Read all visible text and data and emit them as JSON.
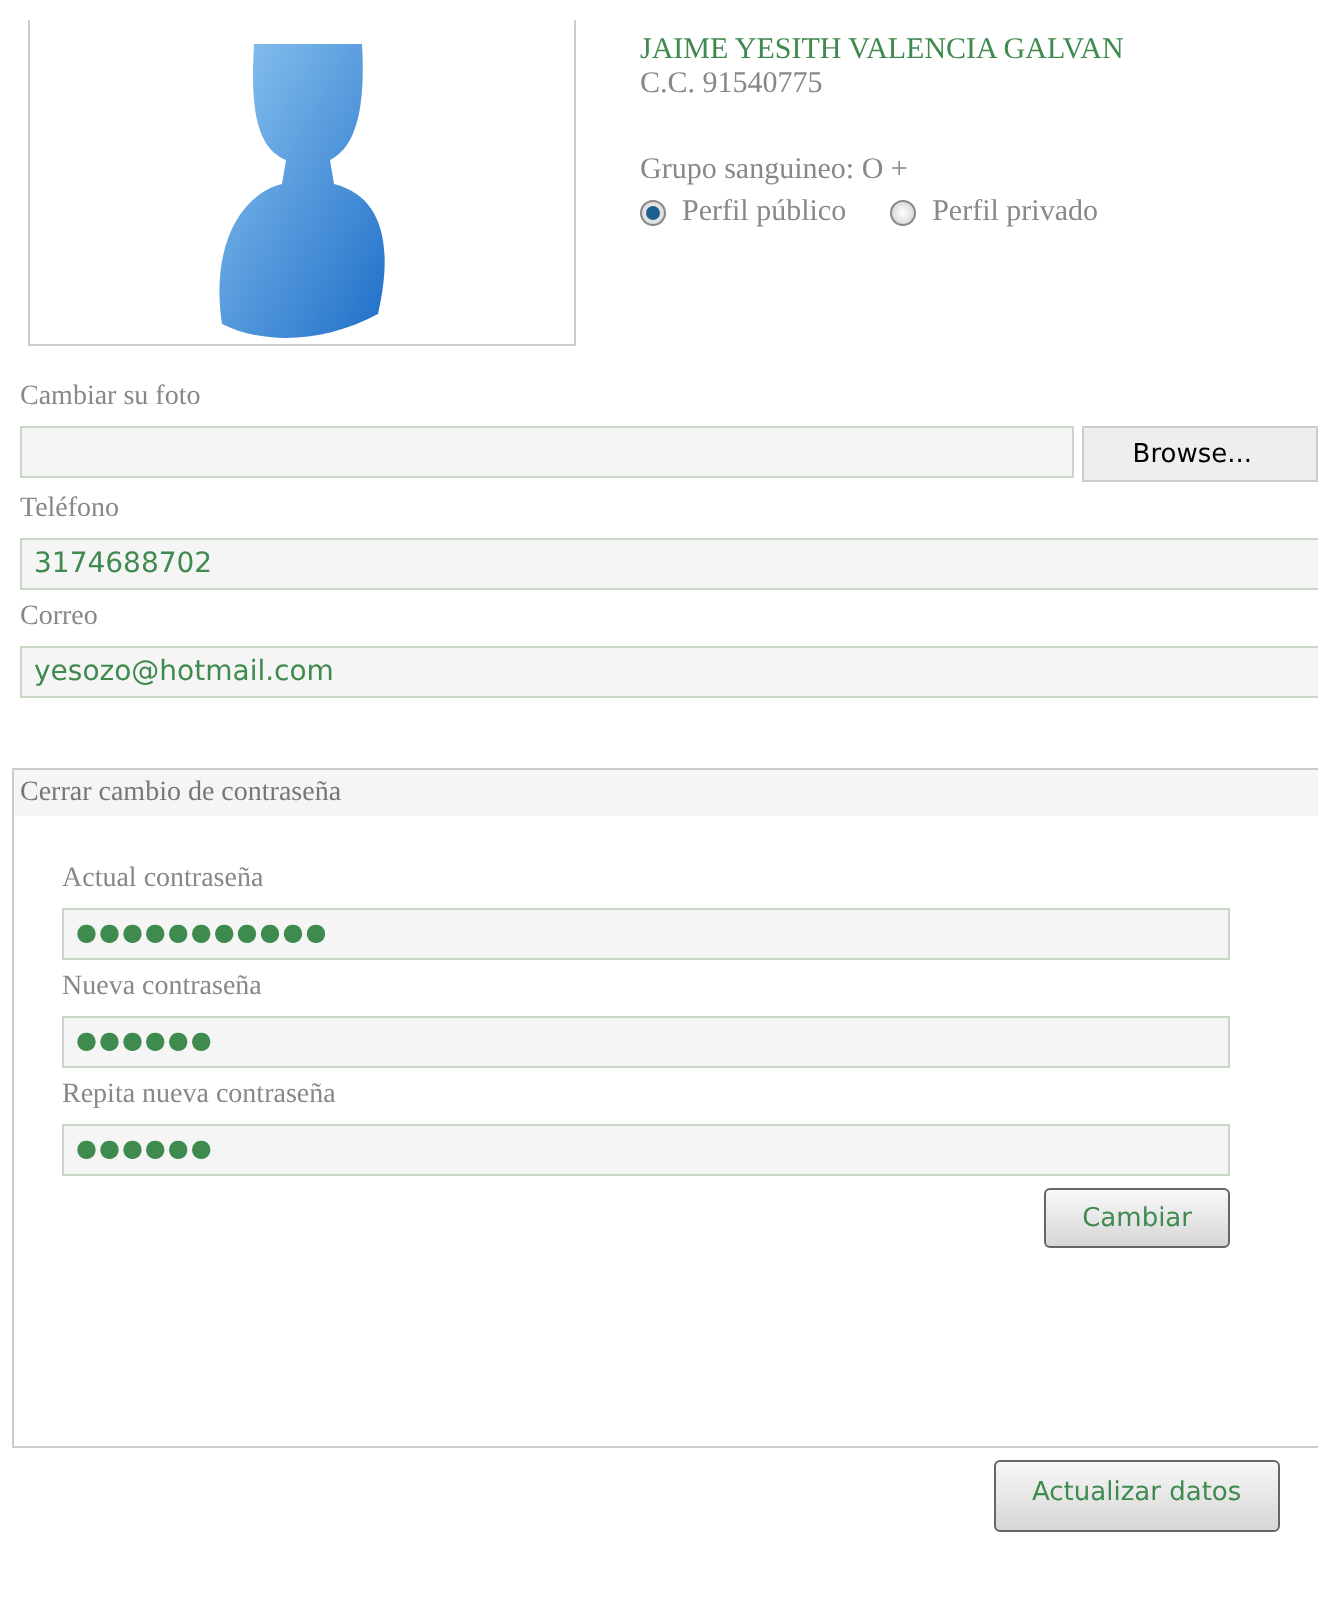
{
  "profile": {
    "name": "JAIME YESITH VALENCIA GALVAN",
    "id_line": "C.C. 91540775",
    "blood_type": "Grupo sanguineo: O +",
    "visibility": [
      {
        "label": "Perfil público",
        "selected": true
      },
      {
        "label": "Perfil privado",
        "selected": false
      }
    ]
  },
  "photo": {
    "label": "Cambiar su foto",
    "button": "Browse..."
  },
  "fields": [
    {
      "label": "Teléfono",
      "value": "3174688702"
    },
    {
      "label": "Correo",
      "value": "yesozo@hotmail.com"
    }
  ],
  "password_panel": {
    "title": "Cerrar cambio de contraseña",
    "fields": [
      {
        "label": "Actual contraseña",
        "value": "●●●●●●●●●●●"
      },
      {
        "label": "Nueva contraseña",
        "value": "●●●●●●"
      },
      {
        "label": "Repita nueva contraseña",
        "value": "●●●●●●"
      }
    ],
    "button": "Cambiar"
  },
  "submit_button": "Actualizar datos"
}
